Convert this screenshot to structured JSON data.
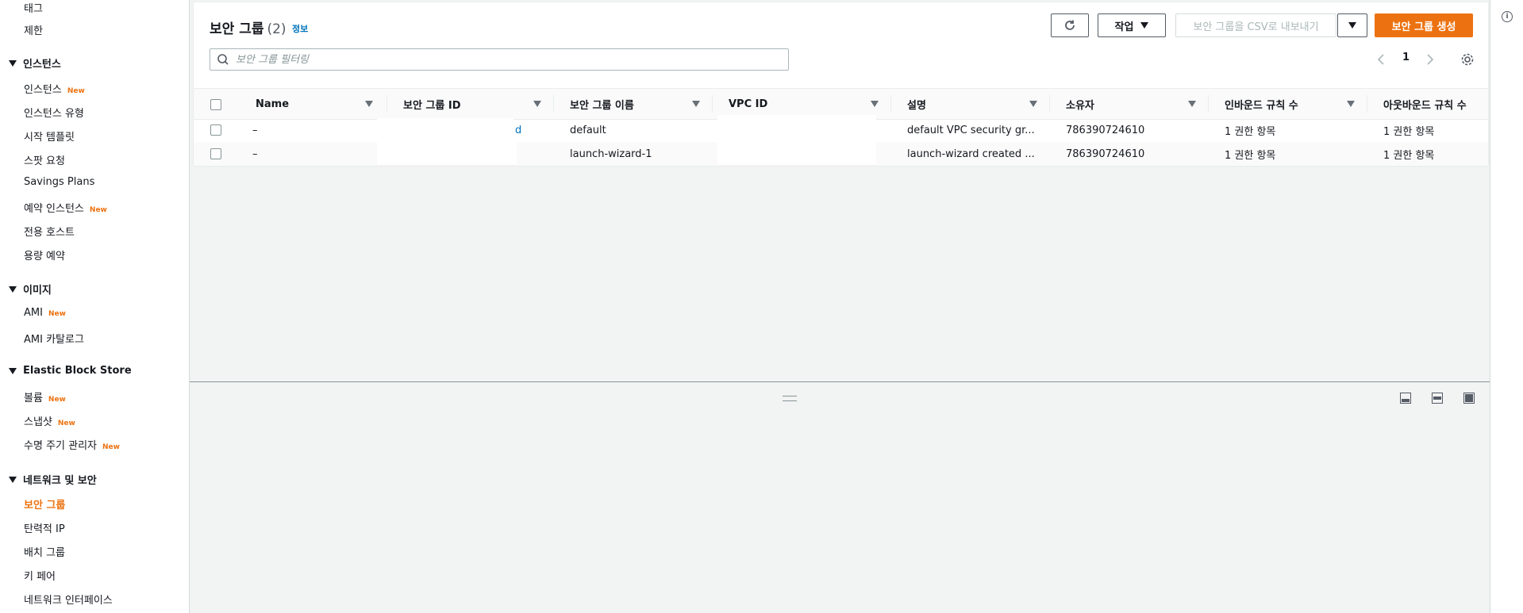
{
  "sidebar": {
    "items": [
      {
        "label": "태그"
      },
      {
        "label": "제한"
      }
    ],
    "sections": [
      {
        "title": "인스턴스",
        "items": [
          {
            "label": "인스턴스",
            "badge": "New"
          },
          {
            "label": "인스턴스 유형"
          },
          {
            "label": "시작 템플릿"
          },
          {
            "label": "스팟 요청"
          },
          {
            "label": "Savings Plans"
          },
          {
            "label": "예약 인스턴스",
            "badge": "New"
          },
          {
            "label": "전용 호스트"
          },
          {
            "label": "용량 예약"
          }
        ]
      },
      {
        "title": "이미지",
        "items": [
          {
            "label": "AMI",
            "badge": "New"
          },
          {
            "label": "AMI 카탈로그"
          }
        ]
      },
      {
        "title": "Elastic Block Store",
        "items": [
          {
            "label": "볼륨",
            "badge": "New"
          },
          {
            "label": "스냅샷",
            "badge": "New"
          },
          {
            "label": "수명 주기 관리자",
            "badge": "New"
          }
        ]
      },
      {
        "title": "네트워크 및 보안",
        "items": [
          {
            "label": "보안 그룹",
            "active": true
          },
          {
            "label": "탄력적 IP"
          },
          {
            "label": "배치 그룹"
          },
          {
            "label": "키 페어"
          },
          {
            "label": "네트워크 인터페이스"
          }
        ]
      }
    ]
  },
  "header": {
    "title": "보안 그룹",
    "count": "(2)",
    "info_link": "정보"
  },
  "toolbar": {
    "actions_label": "작업",
    "export_label": "보안 그룹을 CSV로 내보내기",
    "create_label": "보안 그룹 생성"
  },
  "search": {
    "placeholder": "보안 그룹 필터링"
  },
  "pagination": {
    "current_page": "1"
  },
  "table": {
    "columns": [
      "Name",
      "보안 그룹 ID",
      "보안 그룹 이름",
      "VPC ID",
      "설명",
      "소유자",
      "인바운드 규칙 수",
      "아웃바운드 규칙 수"
    ],
    "rows": [
      {
        "name": "–",
        "id_visible": "d",
        "group_name": "default",
        "vpc_id": "",
        "description": "default VPC security gr...",
        "owner": "786390724610",
        "inbound": "1 권한 항목",
        "outbound": "1 권한 항목"
      },
      {
        "name": "–",
        "id_visible": "",
        "group_name": "launch-wizard-1",
        "vpc_id": "",
        "description": "launch-wizard created ...",
        "owner": "786390724610",
        "inbound": "1 권한 항목",
        "outbound": "1 권한 항목"
      }
    ]
  },
  "colors": {
    "accent": "#ec7211",
    "link": "#0073bb",
    "text": "#16191f",
    "background": "#f2f3f3"
  }
}
